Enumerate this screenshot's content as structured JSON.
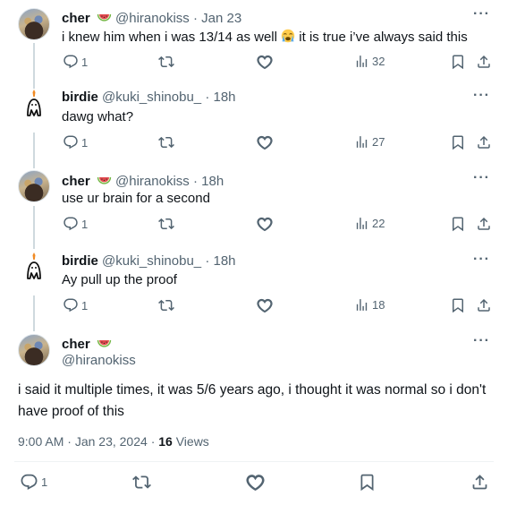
{
  "posts": [
    {
      "name": "cher",
      "handle": "@hiranokiss",
      "sep": "·",
      "date": "Jan 23",
      "text_a": "i knew him when i was 13/14 as well",
      "text_b": "it is true i’ve always said this",
      "replies": "1",
      "views": "32"
    },
    {
      "name": "birdie",
      "handle": "@kuki_shinobu_",
      "sep": "·",
      "date": "18h",
      "text": "dawg what?",
      "replies": "1",
      "views": "27"
    },
    {
      "name": "cher",
      "handle": "@hiranokiss",
      "sep": "·",
      "date": "18h",
      "text": "use ur brain for a second",
      "replies": "1",
      "views": "22"
    },
    {
      "name": "birdie",
      "handle": "@kuki_shinobu_",
      "sep": "·",
      "date": "18h",
      "text": "Ay pull up the proof",
      "replies": "1",
      "views": "18"
    }
  ],
  "main": {
    "name": "cher",
    "handle": "@hiranokiss",
    "text": "i said it multiple times, it was 5/6 years ago, i thought it was normal so i don't have proof of this",
    "time": "9:00 AM",
    "sep": "·",
    "date": "Jan 23, 2024",
    "sep2": "·",
    "views_count": "16",
    "views_label": "Views",
    "replies": "1"
  },
  "more_label": "···",
  "icons": {
    "reply": "reply-icon",
    "retweet": "retweet-icon",
    "like": "heart-icon",
    "views": "views-chart-icon",
    "bookmark": "bookmark-icon",
    "share": "share-icon",
    "watermelon": "watermelon-emoji",
    "crying": "loudly-crying-emoji"
  },
  "colors": {
    "text": "#0f1419",
    "muted": "#536471",
    "thread_line": "#cfd9de"
  }
}
